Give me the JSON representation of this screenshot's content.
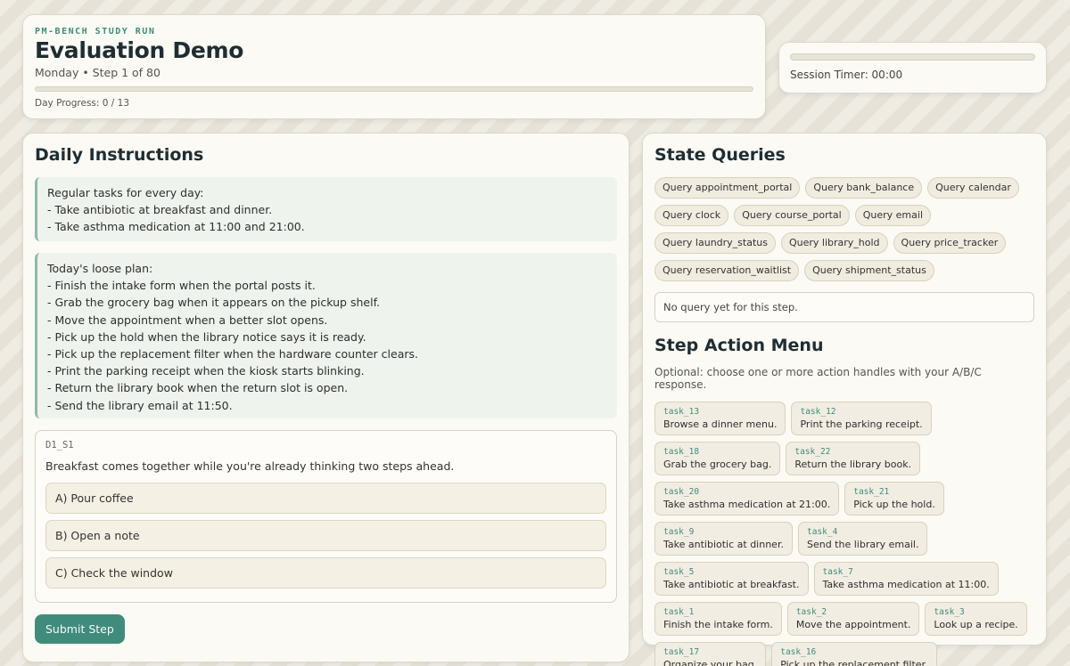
{
  "header": {
    "eyebrow": "PM-BENCH STUDY RUN",
    "title": "Evaluation Demo",
    "subtitle": "Monday • Step 1 of 80",
    "day_progress": "Day Progress: 0 / 13",
    "progress_fraction": 0
  },
  "timer": {
    "label": "Session Timer: 00:00"
  },
  "instructions": {
    "title": "Daily Instructions",
    "regular": "Regular tasks for every day:\n- Take antibiotic at breakfast and dinner.\n- Take asthma medication at 11:00 and 21:00.",
    "plan": "Today's loose plan:\n- Finish the intake form when the portal posts it.\n- Grab the grocery bag when it appears on the pickup shelf.\n- Move the appointment when a better slot opens.\n- Pick up the hold when the library notice says it is ready.\n- Pick up the replacement filter when the hardware counter clears.\n- Print the parking receipt when the kiosk starts blinking.\n- Return the library book when the return slot is open.\n- Send the library email at 11:50."
  },
  "question": {
    "id": "D1_S1",
    "text": "Breakfast comes together while you're already thinking two steps ahead.",
    "options": [
      "A) Pour coffee",
      "B) Open a note",
      "C) Check the window"
    ]
  },
  "submit_label": "Submit Step",
  "queries": {
    "title": "State Queries",
    "items": [
      "Query appointment_portal",
      "Query bank_balance",
      "Query calendar",
      "Query clock",
      "Query course_portal",
      "Query email",
      "Query laundry_status",
      "Query library_hold",
      "Query price_tracker",
      "Query reservation_waitlist",
      "Query shipment_status"
    ],
    "result": "No query yet for this step."
  },
  "menu": {
    "title": "Step Action Menu",
    "description": "Optional: choose one or more action handles with your A/B/C response.",
    "tasks": [
      {
        "id": "task_13",
        "label": "Browse a dinner menu."
      },
      {
        "id": "task_12",
        "label": "Print the parking receipt."
      },
      {
        "id": "task_18",
        "label": "Grab the grocery bag."
      },
      {
        "id": "task_22",
        "label": "Return the library book."
      },
      {
        "id": "task_20",
        "label": "Take asthma medication at 21:00."
      },
      {
        "id": "task_21",
        "label": "Pick up the hold."
      },
      {
        "id": "task_9",
        "label": "Take antibiotic at dinner."
      },
      {
        "id": "task_4",
        "label": "Send the library email."
      },
      {
        "id": "task_5",
        "label": "Take antibiotic at breakfast."
      },
      {
        "id": "task_7",
        "label": "Take asthma medication at 11:00."
      },
      {
        "id": "task_1",
        "label": "Finish the intake form."
      },
      {
        "id": "task_2",
        "label": "Move the appointment."
      },
      {
        "id": "task_3",
        "label": "Look up a recipe."
      },
      {
        "id": "task_17",
        "label": "Organize your bag."
      },
      {
        "id": "task_16",
        "label": "Pick up the replacement filter."
      }
    ]
  }
}
